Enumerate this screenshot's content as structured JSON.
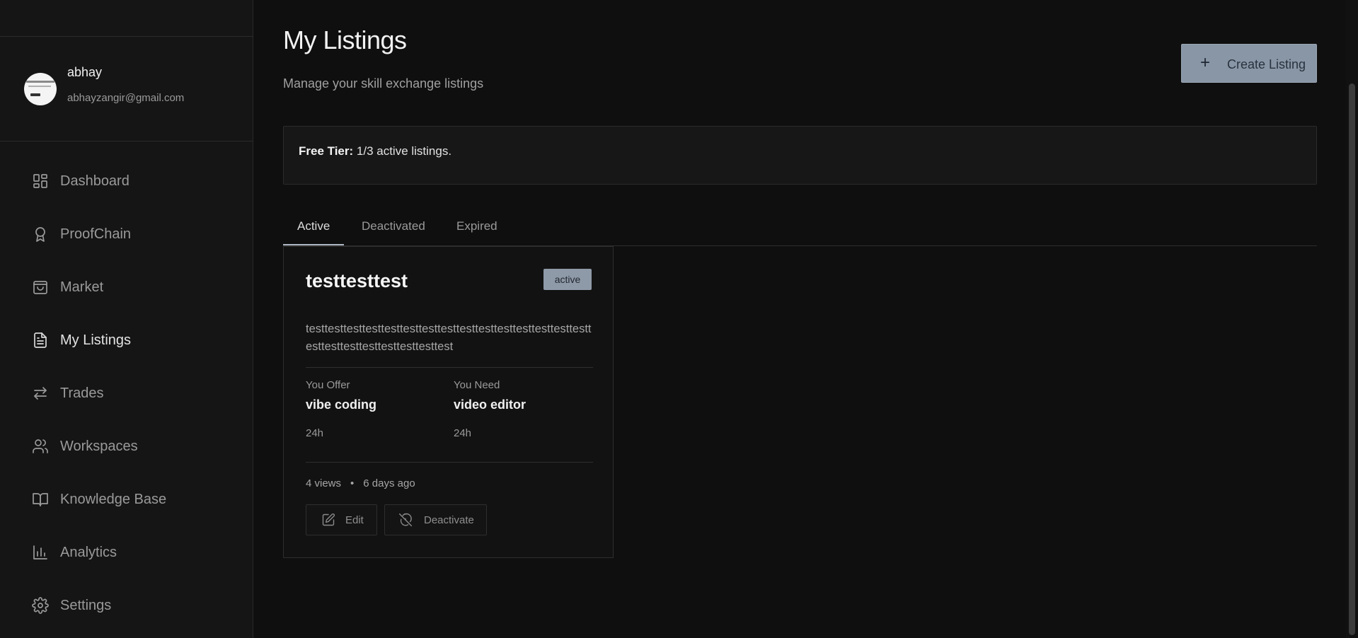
{
  "profile": {
    "name": "abhay",
    "email": "abhayzangir@gmail.com"
  },
  "sidebar": {
    "items": [
      {
        "label": "Dashboard",
        "icon": "dashboard-icon"
      },
      {
        "label": "ProofChain",
        "icon": "award-icon"
      },
      {
        "label": "Market",
        "icon": "shopping-bag-icon"
      },
      {
        "label": "My Listings",
        "icon": "file-text-icon",
        "active": true
      },
      {
        "label": "Trades",
        "icon": "swap-arrows-icon"
      },
      {
        "label": "Workspaces",
        "icon": "users-icon"
      },
      {
        "label": "Knowledge Base",
        "icon": "book-open-icon"
      },
      {
        "label": "Analytics",
        "icon": "bar-chart-icon"
      },
      {
        "label": "Settings",
        "icon": "gear-icon"
      }
    ]
  },
  "header": {
    "title": "My Listings",
    "subtitle": "Manage your skill exchange listings",
    "create_label": "Create Listing",
    "create_icon": "+"
  },
  "tier": {
    "label": "Free Tier:",
    "text": " 1/3 active listings."
  },
  "tabs": [
    {
      "label": "Active",
      "active": true
    },
    {
      "label": "Deactivated"
    },
    {
      "label": "Expired"
    }
  ],
  "listing": {
    "title": "testtesttest",
    "status": "active",
    "description": "testtesttesttesttesttesttesttesttesttesttesttesttesttesttesttesttesttesttesttesttesttesttest",
    "offer_label": "You Offer",
    "offer_skill": "vibe coding",
    "offer_duration": "24h",
    "need_label": "You Need",
    "need_skill": "video editor",
    "need_duration": "24h",
    "views": "4 views",
    "separator": "•",
    "age": "6 days ago",
    "edit_label": "Edit",
    "deactivate_label": "Deactivate"
  },
  "colors": {
    "background": "#0f0f0f",
    "sidebar": "#151515",
    "accent_button": "#8896a6",
    "badge": "#8f9aa8"
  }
}
